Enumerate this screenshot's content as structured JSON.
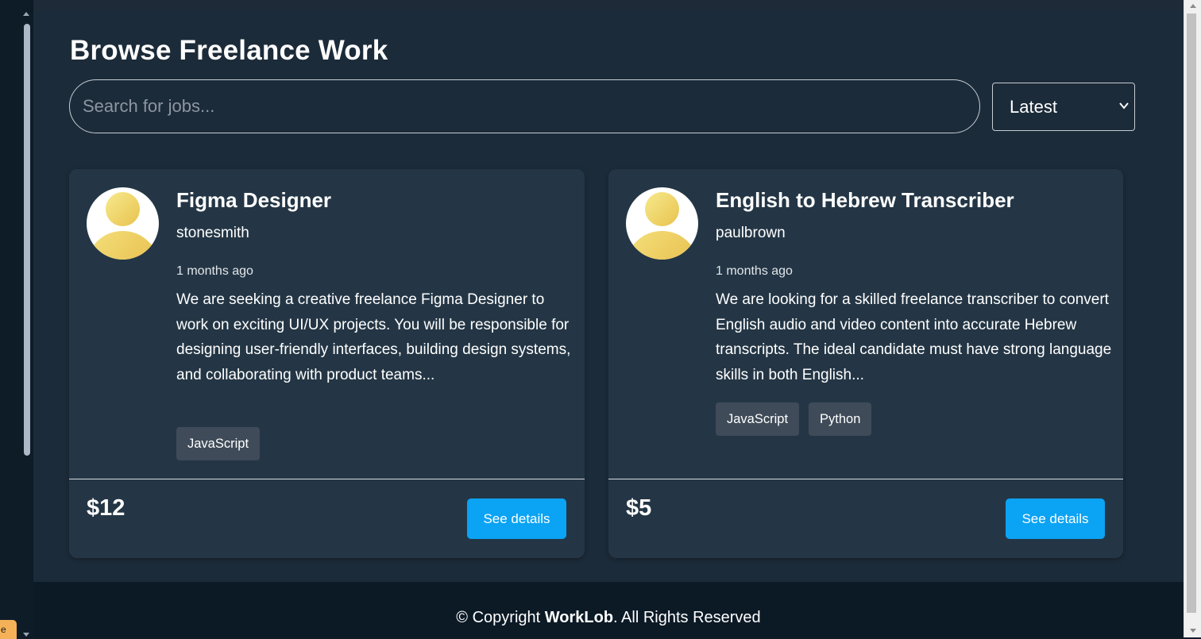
{
  "page": {
    "title": "Browse Freelance Work"
  },
  "search": {
    "placeholder": "Search for jobs...",
    "value": ""
  },
  "sort": {
    "selected": "Latest"
  },
  "jobs": [
    {
      "title": "Figma Designer",
      "user": "stonesmith",
      "posted": "1 months ago",
      "description": "We are seeking a creative freelance Figma Designer to work on exciting UI/UX projects. You will be responsible for designing user-friendly interfaces, building design systems, and collaborating with product teams...",
      "tags": [
        "JavaScript"
      ],
      "price": "$12",
      "button_label": "See details"
    },
    {
      "title": "English to Hebrew Transcriber",
      "user": "paulbrown",
      "posted": "1 months ago",
      "description": "We are looking for a skilled freelance transcriber to convert English audio and video content into accurate Hebrew transcripts. The ideal candidate must have strong language skills in both English...",
      "tags": [
        "JavaScript",
        "Python"
      ],
      "price": "$5",
      "button_label": "See details"
    }
  ],
  "footer": {
    "prefix": "© Copyright ",
    "brand": "WorkLob",
    "suffix": ". All Rights Reserved"
  },
  "corner_chip": {
    "text": "e"
  },
  "colors": {
    "background": "#0e1c28",
    "main_bg": "#1c2b39",
    "card_bg": "#243645",
    "tag_bg": "#3f4b58",
    "accent_button": "#0ba3f3",
    "avatar_gold": "#e8c24f"
  },
  "icons": {
    "sort_dropdown": "chevron-down-icon",
    "avatar": "user-avatar-icon"
  }
}
